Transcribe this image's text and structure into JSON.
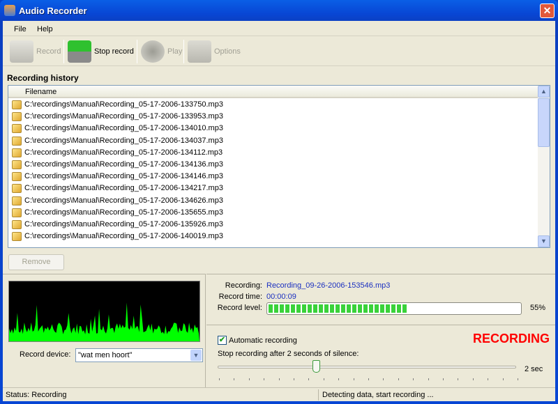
{
  "window": {
    "title": "Audio Recorder",
    "close": "✕"
  },
  "menu": {
    "file": "File",
    "help": "Help"
  },
  "toolbar": {
    "record": "Record",
    "stop_record": "Stop record",
    "play": "Play",
    "options": "Options"
  },
  "history": {
    "label": "Recording history",
    "column_filename": "Filename",
    "rows": [
      "C:\\recordings\\Manual\\Recording_05-17-2006-133750.mp3",
      "C:\\recordings\\Manual\\Recording_05-17-2006-133953.mp3",
      "C:\\recordings\\Manual\\Recording_05-17-2006-134010.mp3",
      "C:\\recordings\\Manual\\Recording_05-17-2006-134037.mp3",
      "C:\\recordings\\Manual\\Recording_05-17-2006-134112.mp3",
      "C:\\recordings\\Manual\\Recording_05-17-2006-134136.mp3",
      "C:\\recordings\\Manual\\Recording_05-17-2006-134146.mp3",
      "C:\\recordings\\Manual\\Recording_05-17-2006-134217.mp3",
      "C:\\recordings\\Manual\\Recording_05-17-2006-134626.mp3",
      "C:\\recordings\\Manual\\Recording_05-17-2006-135655.mp3",
      "C:\\recordings\\Manual\\Recording_05-17-2006-135926.mp3",
      "C:\\recordings\\Manual\\Recording_05-17-2006-140019.mp3"
    ],
    "remove": "Remove"
  },
  "device": {
    "label": "Record device:",
    "value": "\"wat men hoort\""
  },
  "info": {
    "recording_label": "Recording:",
    "recording_value": "Recording_09-26-2006-153546.mp3",
    "time_label": "Record time:",
    "time_value": "00:00:09",
    "level_label": "Record level:",
    "level_percent": 55,
    "level_text": "55%"
  },
  "auto": {
    "checkbox_label": "Automatic recording",
    "checked": true,
    "silence_label": "Stop recording after 2 seconds of silence:",
    "slider_value": "2 sec",
    "slider_fraction": 0.33,
    "state": "RECORDING"
  },
  "status": {
    "left": "Status: Recording",
    "right": "Detecting data, start recording ..."
  },
  "colors": {
    "accent_red": "#ff0000",
    "meter_green": "#3ad23a",
    "wave_green": "#00ff00"
  }
}
